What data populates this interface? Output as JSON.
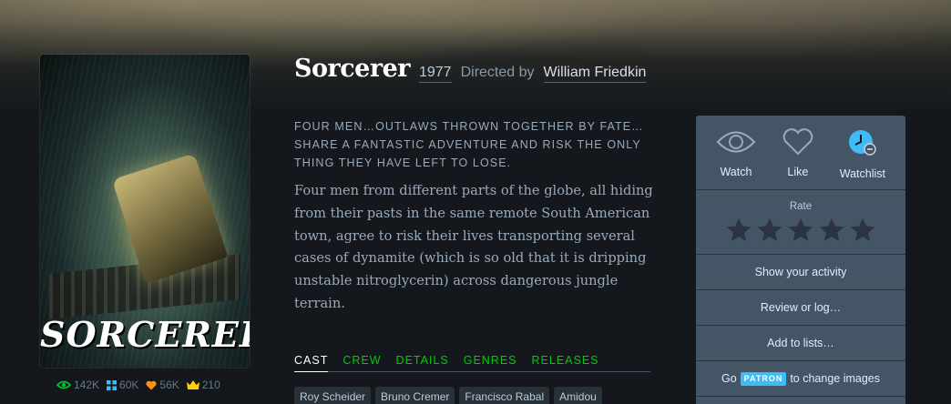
{
  "film": {
    "title": "Sorcerer",
    "year": "1977",
    "directed_by_label": "Directed by",
    "director": "William Friedkin",
    "tagline": "FOUR MEN…OUTLAWS THROWN TOGETHER BY FATE… SHARE A FANTASTIC ADVENTURE AND RISK THE ONLY THING THEY HAVE LEFT TO LOSE.",
    "synopsis": "Four men from different parts of the globe, all hiding from their pasts in the same remote South American town, agree to risk their lives transporting several cases of dynamite (which is so old that it is dripping unstable nitroglycerin) across dangerous jungle terrain.",
    "poster_title": "SORCERER"
  },
  "stats": {
    "watched": "142K",
    "lists": "60K",
    "likes": "56K",
    "top": "210"
  },
  "tabs": [
    {
      "label": "CAST"
    },
    {
      "label": "CREW"
    },
    {
      "label": "DETAILS"
    },
    {
      "label": "GENRES"
    },
    {
      "label": "RELEASES"
    }
  ],
  "cast": [
    "Roy Scheider",
    "Bruno Cremer",
    "Francisco Rabal",
    "Amidou"
  ],
  "panel": {
    "watch_label": "Watch",
    "like_label": "Like",
    "watchlist_label": "Watchlist",
    "rate_label": "Rate",
    "show_activity": "Show your activity",
    "review_log": "Review or log…",
    "add_lists": "Add to lists…",
    "go_label": "Go",
    "patron_badge": "PATRON",
    "change_images": "to change images"
  },
  "colors": {
    "background": "#14181c",
    "accent_green": "#00c030",
    "watchlist_blue": "#40bcf4",
    "panel": "#445566"
  }
}
